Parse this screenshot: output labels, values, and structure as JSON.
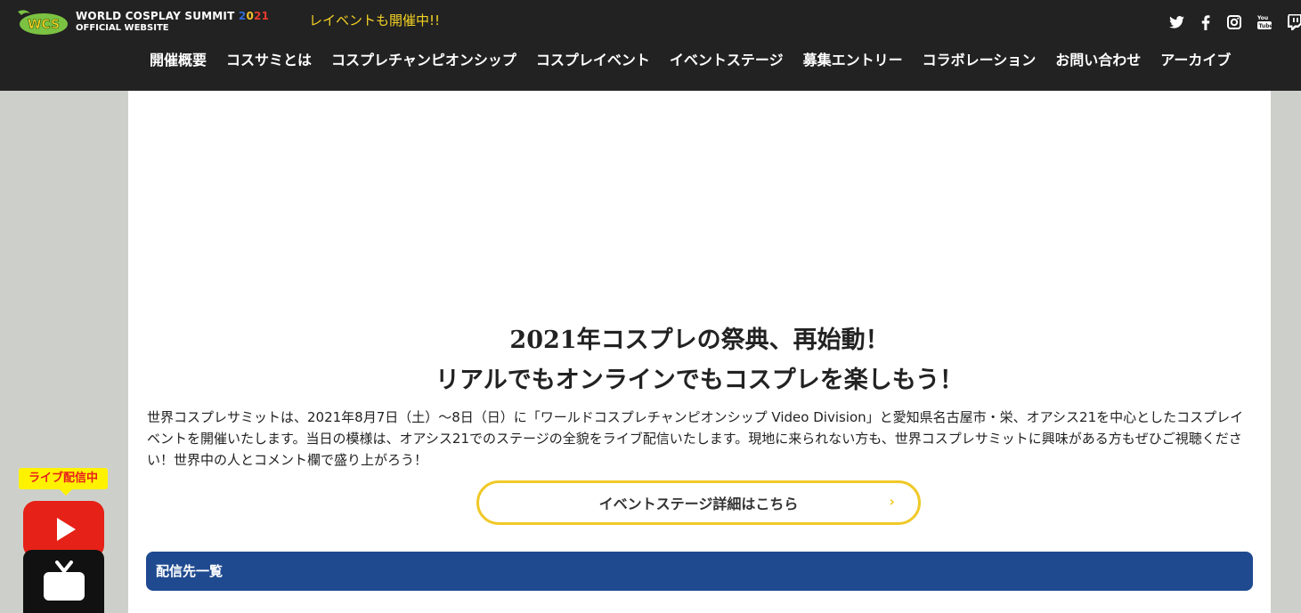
{
  "header": {
    "logo_line1": "WORLD COSPLAY SUMMIT",
    "logo_year": [
      "2",
      "0",
      "2",
      "1"
    ],
    "logo_line2": "OFFICIAL WEBSITE",
    "ticker": "レイベントも開催中!!"
  },
  "social": [
    "twitter-icon",
    "facebook-icon",
    "instagram-icon",
    "youtube-icon",
    "twitch-icon"
  ],
  "nav": {
    "items": [
      "開催概要",
      "コスサミとは",
      "コスプレチャンピオンシップ",
      "コスプレイベント",
      "イベントステージ",
      "募集エントリー",
      "コラボレーション",
      "お問い合わせ",
      "アーカイブ"
    ]
  },
  "main": {
    "headline1": "2021年コスプレの祭典、再始動！",
    "headline2": "リアルでもオンラインでもコスプレを楽しもう！",
    "body": "世界コスプレサミットは、2021年8月7日（土）～8日（日）に「ワールドコスプレチャンピオンシップ Video Division」と愛知県名古屋市・栄、オアシス21を中心としたコスプレイベントを開催いたします。当日の模様は、オアシス21でのステージの全貌をライブ配信いたします。現地に来られない方も、世界コスプレサミットに興味がある方もぜひご視聴ください！世界中の人とコメント欄で盛り上がろう！",
    "cta": "イベントステージ詳細はこちら",
    "cta_chevron": "›",
    "stream_title": "配信先一覧"
  },
  "live": {
    "badge": "ライブ配信中"
  },
  "colors": {
    "header_bg": "#222222",
    "ticker": "#f4d224",
    "cta_border": "#f0c928",
    "stream_bar": "#1f4a8f",
    "youtube_red": "#e62117",
    "page_bg": "#cdd0ca"
  }
}
